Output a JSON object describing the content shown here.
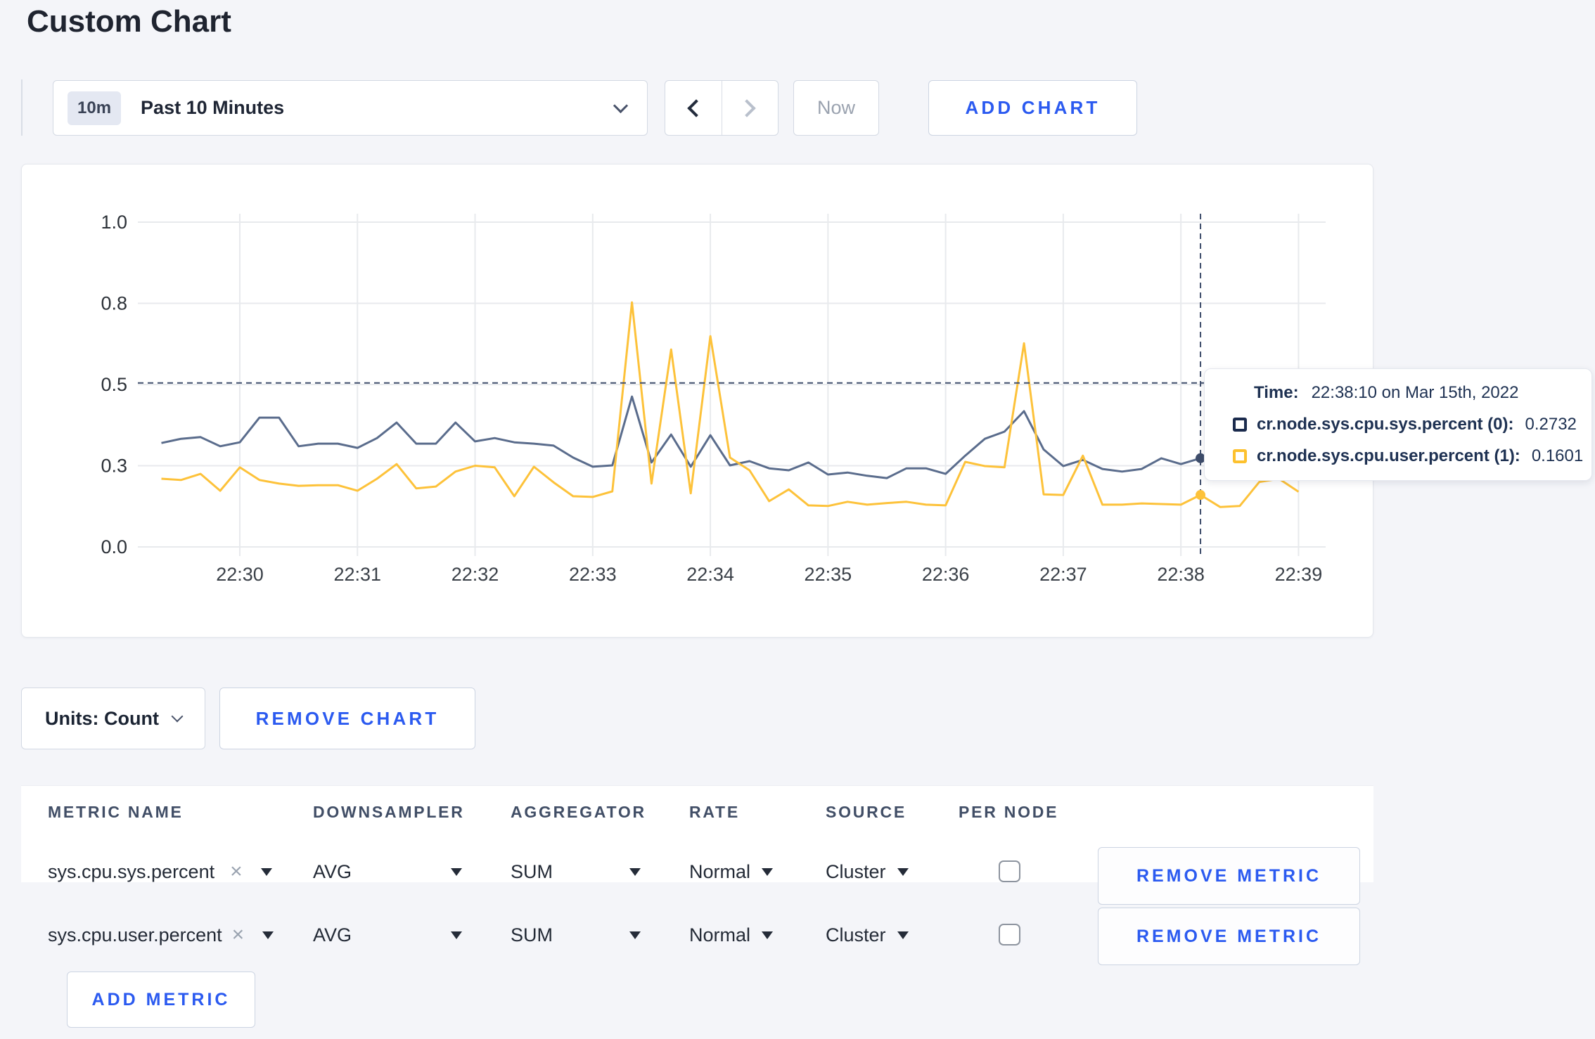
{
  "page": {
    "title": "Custom Chart",
    "background": "#f4f5f9",
    "accent_blue": "#2b5af0"
  },
  "toolbar": {
    "time_badge": "10m",
    "time_label": "Past 10 Minutes",
    "now_label": "Now",
    "add_chart_label": "ADD CHART"
  },
  "chart_data": {
    "type": "line",
    "title": "",
    "xlabel": "",
    "ylabel": "",
    "ylim": [
      0,
      1
    ],
    "grid": true,
    "x_ticks": [
      "22:30",
      "22:31",
      "22:32",
      "22:33",
      "22:34",
      "22:35",
      "22:36",
      "22:37",
      "22:38",
      "22:39"
    ],
    "y_ticks": [
      {
        "label": "0.0",
        "value": 0
      },
      {
        "label": "0.3",
        "value": 0.25
      },
      {
        "label": "0.5",
        "value": 0.5
      },
      {
        "label": "0.8",
        "value": 0.75
      },
      {
        "label": "1.0",
        "value": 1.0
      }
    ],
    "x_start": "22:29:20",
    "x_interval_seconds": 10,
    "series": [
      {
        "name": "cr.node.sys.cpu.sys.percent (0)",
        "color": "#5a6c8c",
        "values": [
          0.32,
          0.333,
          0.338,
          0.31,
          0.322,
          0.398,
          0.398,
          0.31,
          0.318,
          0.318,
          0.305,
          0.335,
          0.383,
          0.318,
          0.318,
          0.383,
          0.325,
          0.335,
          0.322,
          0.318,
          0.312,
          0.275,
          0.247,
          0.251,
          0.463,
          0.26,
          0.346,
          0.247,
          0.344,
          0.251,
          0.264,
          0.242,
          0.236,
          0.26,
          0.223,
          0.229,
          0.219,
          0.212,
          0.242,
          0.242,
          0.225,
          0.281,
          0.333,
          0.355,
          0.418,
          0.3,
          0.249,
          0.268,
          0.24,
          0.232,
          0.24,
          0.273,
          0.255,
          0.2732,
          0.249,
          0.26,
          0.27,
          0.26,
          0.27
        ]
      },
      {
        "name": "cr.node.sys.cpu.user.percent (1)",
        "color": "#fdc23a",
        "values": [
          0.21,
          0.206,
          0.225,
          0.173,
          0.245,
          0.206,
          0.195,
          0.188,
          0.19,
          0.19,
          0.173,
          0.21,
          0.255,
          0.18,
          0.186,
          0.232,
          0.25,
          0.245,
          0.156,
          0.247,
          0.199,
          0.156,
          0.154,
          0.171,
          0.753,
          0.195,
          0.608,
          0.165,
          0.649,
          0.275,
          0.236,
          0.141,
          0.177,
          0.128,
          0.126,
          0.139,
          0.13,
          0.135,
          0.139,
          0.13,
          0.128,
          0.262,
          0.249,
          0.245,
          0.627,
          0.162,
          0.16,
          0.281,
          0.13,
          0.13,
          0.134,
          0.132,
          0.13,
          0.1601,
          0.123,
          0.126,
          0.2,
          0.21,
          0.17
        ]
      }
    ],
    "hover": {
      "time": "22:38:10",
      "index": 53,
      "crosshair_y_value": 0.505
    },
    "legend_position": "tooltip"
  },
  "tooltip": {
    "time_label": "Time:",
    "time_value": "22:38:10 on Mar 15th, 2022",
    "rows": [
      {
        "name": "cr.node.sys.cpu.sys.percent (0):",
        "value": "0.2732",
        "swatch_color": "#1b2b4d"
      },
      {
        "name": "cr.node.sys.cpu.user.percent (1):",
        "value": "0.1601",
        "swatch_color": "#fdc12e"
      }
    ]
  },
  "units_bar": {
    "units_label": "Units: Count",
    "remove_chart_label": "REMOVE CHART"
  },
  "metrics_table": {
    "headers": [
      "METRIC NAME",
      "DOWNSAMPLER",
      "AGGREGATOR",
      "RATE",
      "SOURCE",
      "PER NODE"
    ],
    "rows": [
      {
        "metric": "sys.cpu.sys.percent",
        "clear": "×",
        "downsampler": "AVG",
        "aggregator": "SUM",
        "rate": "Normal",
        "source": "Cluster",
        "per_node_checked": false,
        "remove_label": "REMOVE METRIC"
      },
      {
        "metric": "sys.cpu.user.percent",
        "clear": "×",
        "downsampler": "AVG",
        "aggregator": "SUM",
        "rate": "Normal",
        "source": "Cluster",
        "per_node_checked": false,
        "remove_label": "REMOVE METRIC"
      }
    ],
    "add_metric_label": "ADD METRIC"
  }
}
